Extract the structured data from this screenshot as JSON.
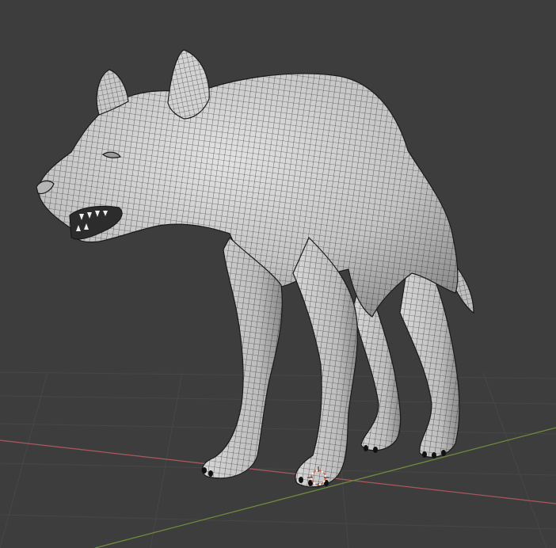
{
  "viewport": {
    "background": "#3d3d3d",
    "grid_line_color": "#474747",
    "x_axis_color": "#a8585c",
    "y_axis_color": "#6e8c3c",
    "mesh_fill": "#cfcfcf",
    "mesh_shadow": "#8a8a8a",
    "wire_color": "#222222",
    "origin_marker_color": "#e05a3a"
  },
  "scene": {
    "object": "hyena-mesh",
    "display_mode": "solid-wireframe",
    "selected_origin": "3d-cursor"
  }
}
